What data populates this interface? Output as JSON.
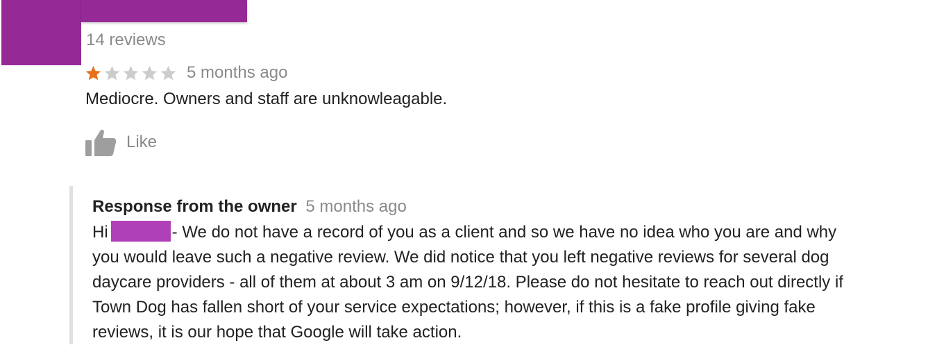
{
  "reviewer": {
    "review_count": "14 reviews"
  },
  "review": {
    "rating": 1,
    "max_rating": 5,
    "date": "5 months ago",
    "text": "Mediocre. Owners and staff are unknowleagable.",
    "like_label": "Like"
  },
  "response": {
    "title": "Response from the owner",
    "date": "5 months ago",
    "greeting": "Hi",
    "lines": [
      "- We do not have a record of you as a client and so we have no idea who you are and why",
      "you would leave such a negative review. We did notice that you left negative reviews for several dog",
      "daycare providers - all of them at about 3 am on 9/12/18. Please do not hesitate to reach out directly if",
      "Town Dog has fallen short of your service expectations; however, if this is a fake profile giving fake",
      "reviews, it is our hope that Google will take action."
    ]
  },
  "colors": {
    "redaction": "#952a96",
    "star_filled": "#e7711b",
    "star_empty": "#cccccc",
    "muted_text": "#8a8a8a",
    "like_icon": "#9e9e9e"
  },
  "icons": {
    "star": "star-icon",
    "like": "thumbs-up-icon"
  }
}
